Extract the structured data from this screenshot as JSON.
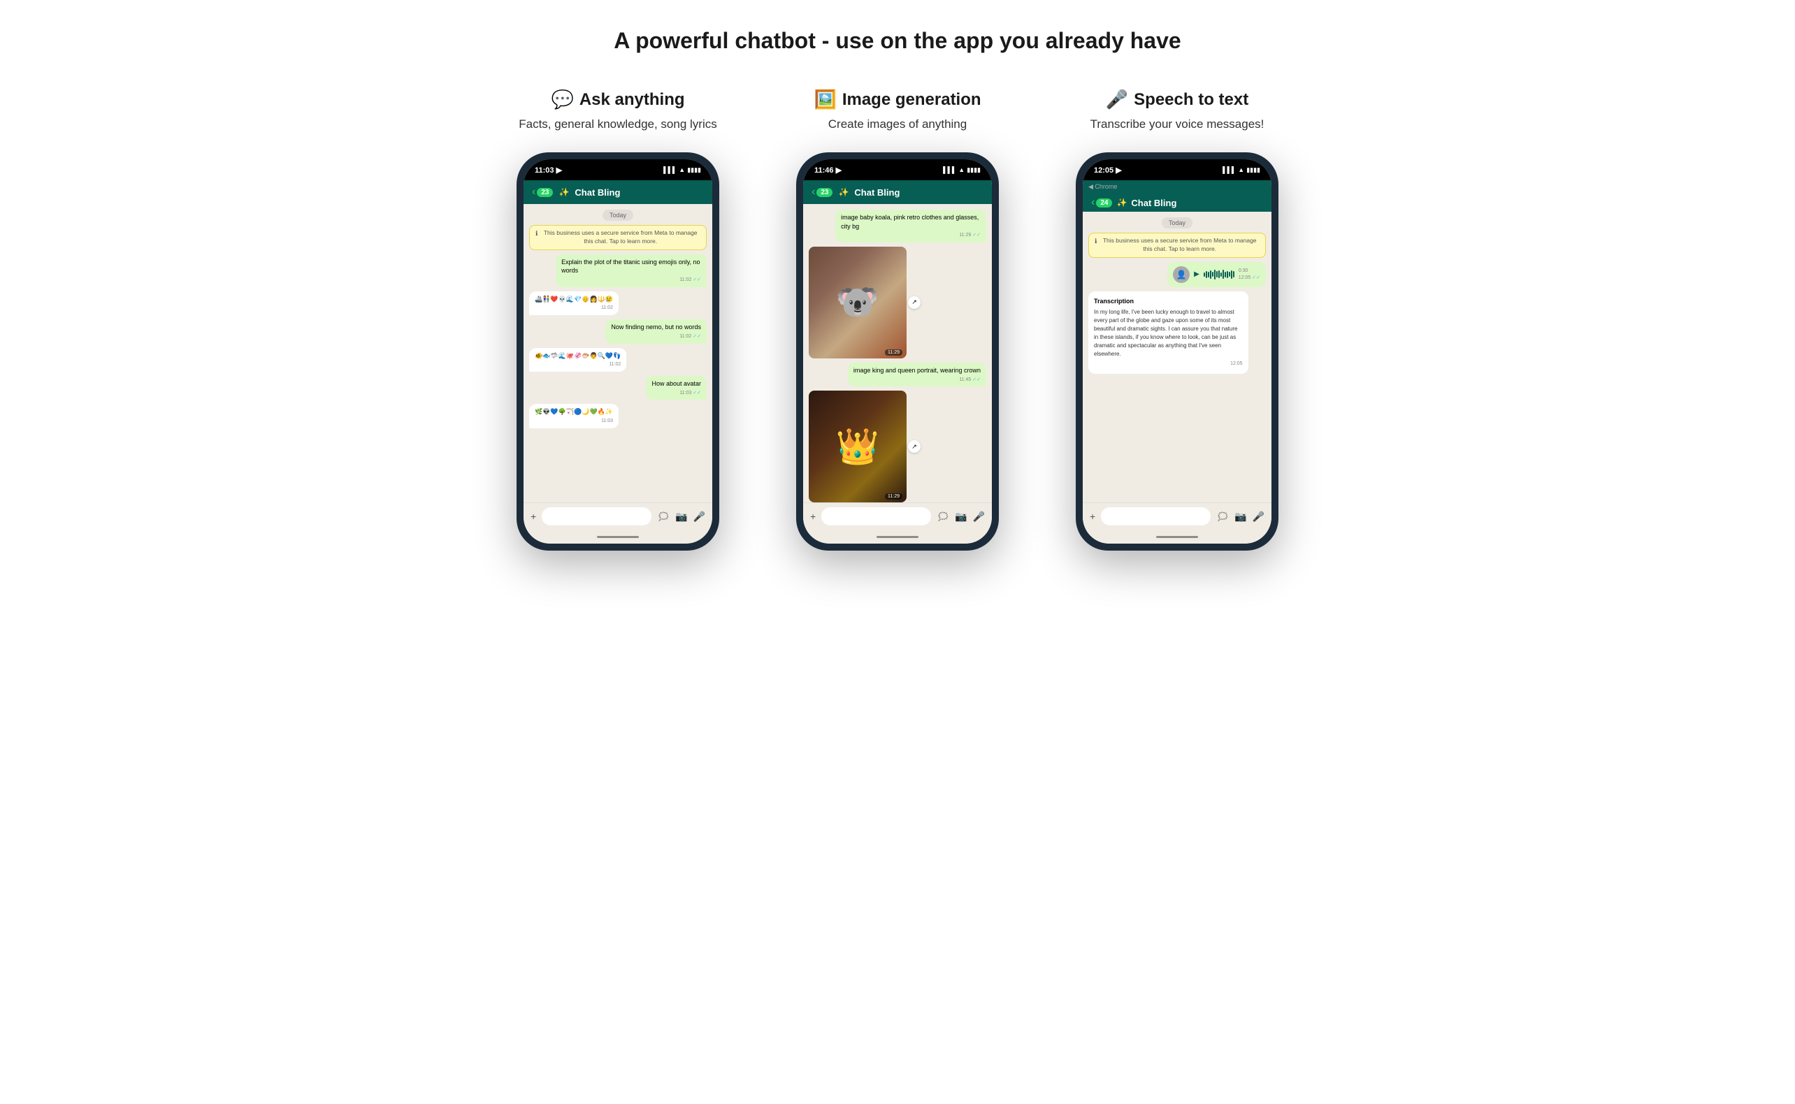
{
  "page": {
    "title": "A powerful chatbot - use on the app you already have"
  },
  "columns": [
    {
      "id": "ask",
      "emoji": "💬",
      "heading": "Ask anything",
      "subtext": "Facts, general knowledge, song lyrics",
      "phone": {
        "time": "11:03",
        "location_icon": "▶",
        "back_count": "23",
        "chat_title": "Chat Bling",
        "messages": [
          {
            "type": "date",
            "text": "Today"
          },
          {
            "type": "system",
            "text": "This business uses a secure service from Meta to manage this chat. Tap to learn more."
          },
          {
            "type": "sent",
            "text": "Explain the plot of the titanic using emojis only, no words",
            "time": "11:02"
          },
          {
            "type": "received",
            "text": "🚢👫❤️💀🌊💎👴👩🔱😢",
            "time": "11:02"
          },
          {
            "type": "sent",
            "text": "Now finding nemo, but no words",
            "time": "11:02"
          },
          {
            "type": "received",
            "text": "🐠🐟🦈🌊🐙🦑🐡👨🔍💙👣",
            "time": "11:02"
          },
          {
            "type": "sent",
            "text": "How about avatar",
            "time": "11:03"
          },
          {
            "type": "received",
            "text": "🌿👽💙🌳🏹🔵🌙💚🔥✨",
            "time": "11:03"
          }
        ]
      }
    },
    {
      "id": "image",
      "emoji": "🖼️",
      "heading": "Image generation",
      "subtext": "Create images of anything",
      "phone": {
        "time": "11:46",
        "back_count": "23",
        "chat_title": "Chat Bling",
        "messages": [
          {
            "type": "sent",
            "text": "image baby koala, pink retro clothes and glasses, city bg",
            "time": "11:29"
          },
          {
            "type": "image",
            "style": "koala",
            "time": "11:29"
          },
          {
            "type": "sent",
            "text": "image king and queen portrait, wearing crown",
            "time": "11:45"
          },
          {
            "type": "image",
            "style": "royals",
            "time": "11:29"
          }
        ]
      }
    },
    {
      "id": "speech",
      "emoji": "🎤",
      "heading": "Speech to text",
      "subtext": "Transcribe your voice messages!",
      "phone": {
        "time": "12:05",
        "back_count": "24",
        "chat_title": "Chat Bling",
        "messages": [
          {
            "type": "date",
            "text": "Today"
          },
          {
            "type": "system",
            "text": "This business uses a secure service from Meta to manage this chat. Tap to learn more."
          },
          {
            "type": "voice",
            "duration": "0:30",
            "time": "12:05"
          },
          {
            "type": "transcription",
            "title": "Transcription",
            "text": "In my long life, I've been lucky enough to travel to almost every part of the globe and gaze upon some of its most beautiful and dramatic sights. I can assure you that nature in these islands, if you know where to look, can be just as dramatic and spectacular as anything that I've seen elsewhere.",
            "time": "12:05"
          }
        ]
      }
    }
  ]
}
